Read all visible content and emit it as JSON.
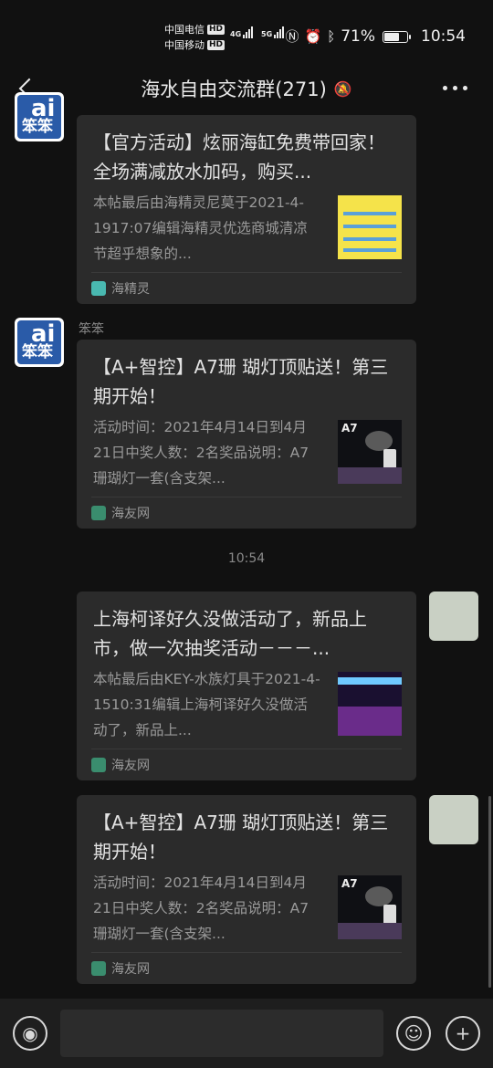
{
  "status_bar": {
    "carrier1": "中国电信",
    "carrier2": "中国移动",
    "hd": "HD",
    "net1": "4G",
    "net2": "5G",
    "nfc_icon": "nfc-icon",
    "alarm_icon": "alarm-icon",
    "bluetooth_icon": "bluetooth-icon",
    "battery_percent": "71%",
    "battery_level": 0.71,
    "time": "10:54"
  },
  "header": {
    "title": "海水自由交流群(271)",
    "back_icon": "back-chevron-icon",
    "mute_icon": "bell-muted-icon",
    "more_icon": "more-dots-icon"
  },
  "messages": [
    {
      "card": {
        "title": "【官方活动】炫丽海缸免费带回家！全场满减放水加码，购买...",
        "description": "本帖最后由海精灵尼莫于2021-4-1917:07编辑海精灵优选商城清凉节超乎想象的...",
        "source": "海精灵"
      }
    },
    {
      "sender": "笨笨",
      "card": {
        "title": "【A+智控】A7珊 瑚灯顶贴送！第三期开始！",
        "description": "活动时间：2021年4月14日到4月21日中奖人数：2名奖品说明：A7珊瑚灯一套(含支架...",
        "thumb_text": "A7",
        "source": "海友网"
      }
    },
    {
      "card": {
        "title": "上海柯译好久没做活动了，新品上市，做一次抽奖活动－－－...",
        "description": "本帖最后由KEY-水族灯具于2021-4-1510:31编辑上海柯译好久没做活动了，新品上...",
        "source": "海友网"
      }
    },
    {
      "card": {
        "title": "【A+智控】A7珊 瑚灯顶贴送！第三期开始！",
        "description": "活动时间：2021年4月14日到4月21日中奖人数：2名奖品说明：A7珊瑚灯一套(含支架...",
        "thumb_text": "A7",
        "source": "海友网"
      }
    }
  ],
  "timestamp": "10:54",
  "avatar_text": {
    "letter": "ai",
    "name": "笨笨"
  },
  "input_bar": {
    "voice_icon": "voice-icon",
    "emoji_icon": "emoji-icon",
    "plus_icon": "plus-icon",
    "placeholder": ""
  }
}
